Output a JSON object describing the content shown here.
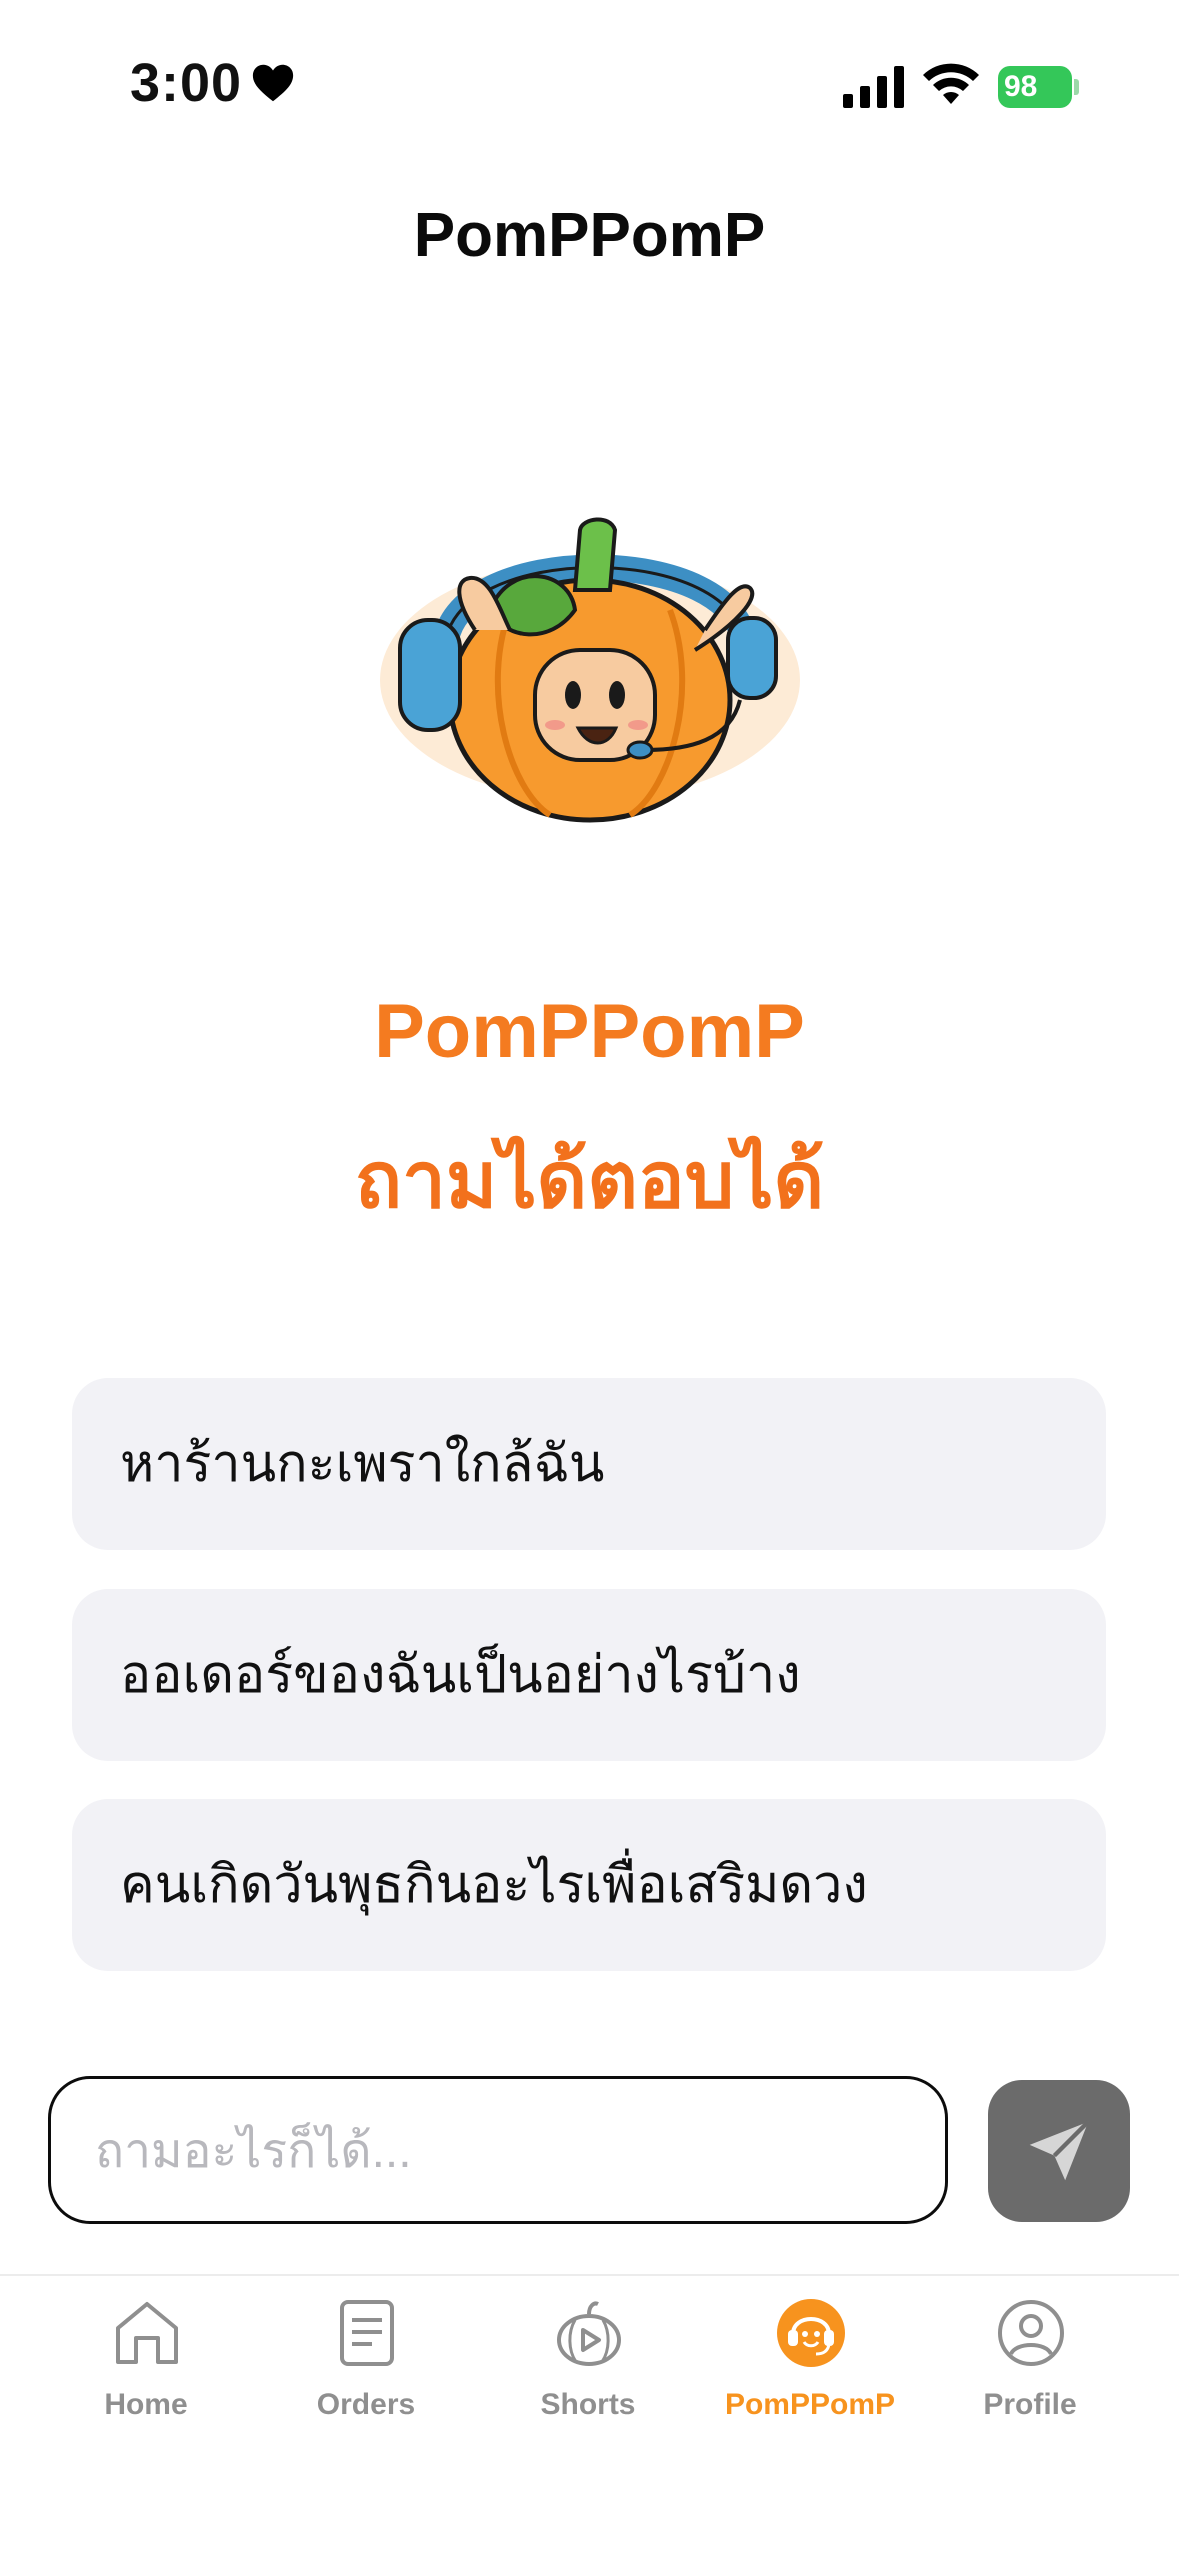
{
  "status_bar": {
    "time": "3:00",
    "battery": "98"
  },
  "header": {
    "title": "PomPPomP"
  },
  "hero": {
    "brand": "PomPPomP",
    "tagline": "ถามได้ตอบได้"
  },
  "suggestions": [
    {
      "label": "หาร้านกะเพราใกล้ฉัน"
    },
    {
      "label": "ออเดอร์ของฉันเป็นอย่างไรบ้าง"
    },
    {
      "label": "คนเกิดวันพุธกินอะไรเพื่อเสริมดวง"
    }
  ],
  "chat": {
    "placeholder": "ถามอะไรก็ได้...",
    "value": "",
    "send_icon": "paper-plane-icon"
  },
  "tabs": [
    {
      "label": "Home",
      "icon": "home-icon"
    },
    {
      "label": "Orders",
      "icon": "document-icon"
    },
    {
      "label": "Shorts",
      "icon": "pumpkin-play-icon"
    },
    {
      "label": "PomPPomP",
      "icon": "pumpkin-headset-icon",
      "active": true
    },
    {
      "label": "Profile",
      "icon": "user-circle-icon"
    }
  ],
  "colors": {
    "accent": "#f47b20",
    "active_tab": "#f7931e",
    "inactive_tab": "#8f8f8f",
    "suggestion_bg": "#f2f2f6",
    "send_button": "#6b6b6b",
    "battery": "#34c759"
  }
}
